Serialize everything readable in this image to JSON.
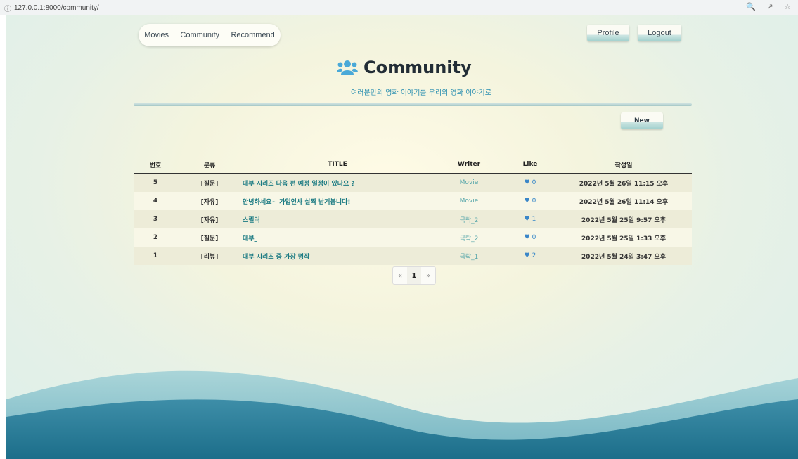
{
  "browser": {
    "info_icon": "info-icon",
    "url": "127.0.0.1:8000/community/"
  },
  "nav": {
    "movies": "Movies",
    "community": "Community",
    "recommend": "Recommend",
    "profile": "Profile",
    "logout": "Logout"
  },
  "header": {
    "icon": "users-icon",
    "title": "Community",
    "subtitle": "여러분만의 영화 이야기를 우리의 영화 이야기로"
  },
  "actions": {
    "new": "New"
  },
  "table": {
    "headers": [
      "번호",
      "분류",
      "TITLE",
      "Writer",
      "Like",
      "작성일"
    ],
    "rows": [
      {
        "no": "5",
        "category": "[질문]",
        "title": "대부 시리즈 다음 편 예정 일정이 있나요 ?",
        "writer": "Movie",
        "likes": "0",
        "date": "2022년 5월 26일 11:15 오후"
      },
      {
        "no": "4",
        "category": "[자유]",
        "title": "안녕하세요~ 가입인사 살짝 남겨봅니다!",
        "writer": "Movie",
        "likes": "0",
        "date": "2022년 5월 26일 11:14 오후"
      },
      {
        "no": "3",
        "category": "[자유]",
        "title": "스릴러",
        "writer": "극락_2",
        "likes": "1",
        "date": "2022년 5월 25일 9:57 오후"
      },
      {
        "no": "2",
        "category": "[질문]",
        "title": "대부_",
        "writer": "극락_2",
        "likes": "0",
        "date": "2022년 5월 25일 1:33 오후"
      },
      {
        "no": "1",
        "category": "[리뷰]",
        "title": "대부 시리즈 중 가장 명작",
        "writer": "극락_1",
        "likes": "2",
        "date": "2022년 5월 24일 3:47 오후"
      }
    ]
  },
  "pagination": {
    "prev": "«",
    "current": "1",
    "next": "»"
  },
  "colors": {
    "accent": "#2a8fb0",
    "title_link": "#1a7a82",
    "like": "#3a86c8",
    "wave_dark": "#1c6e8a"
  }
}
